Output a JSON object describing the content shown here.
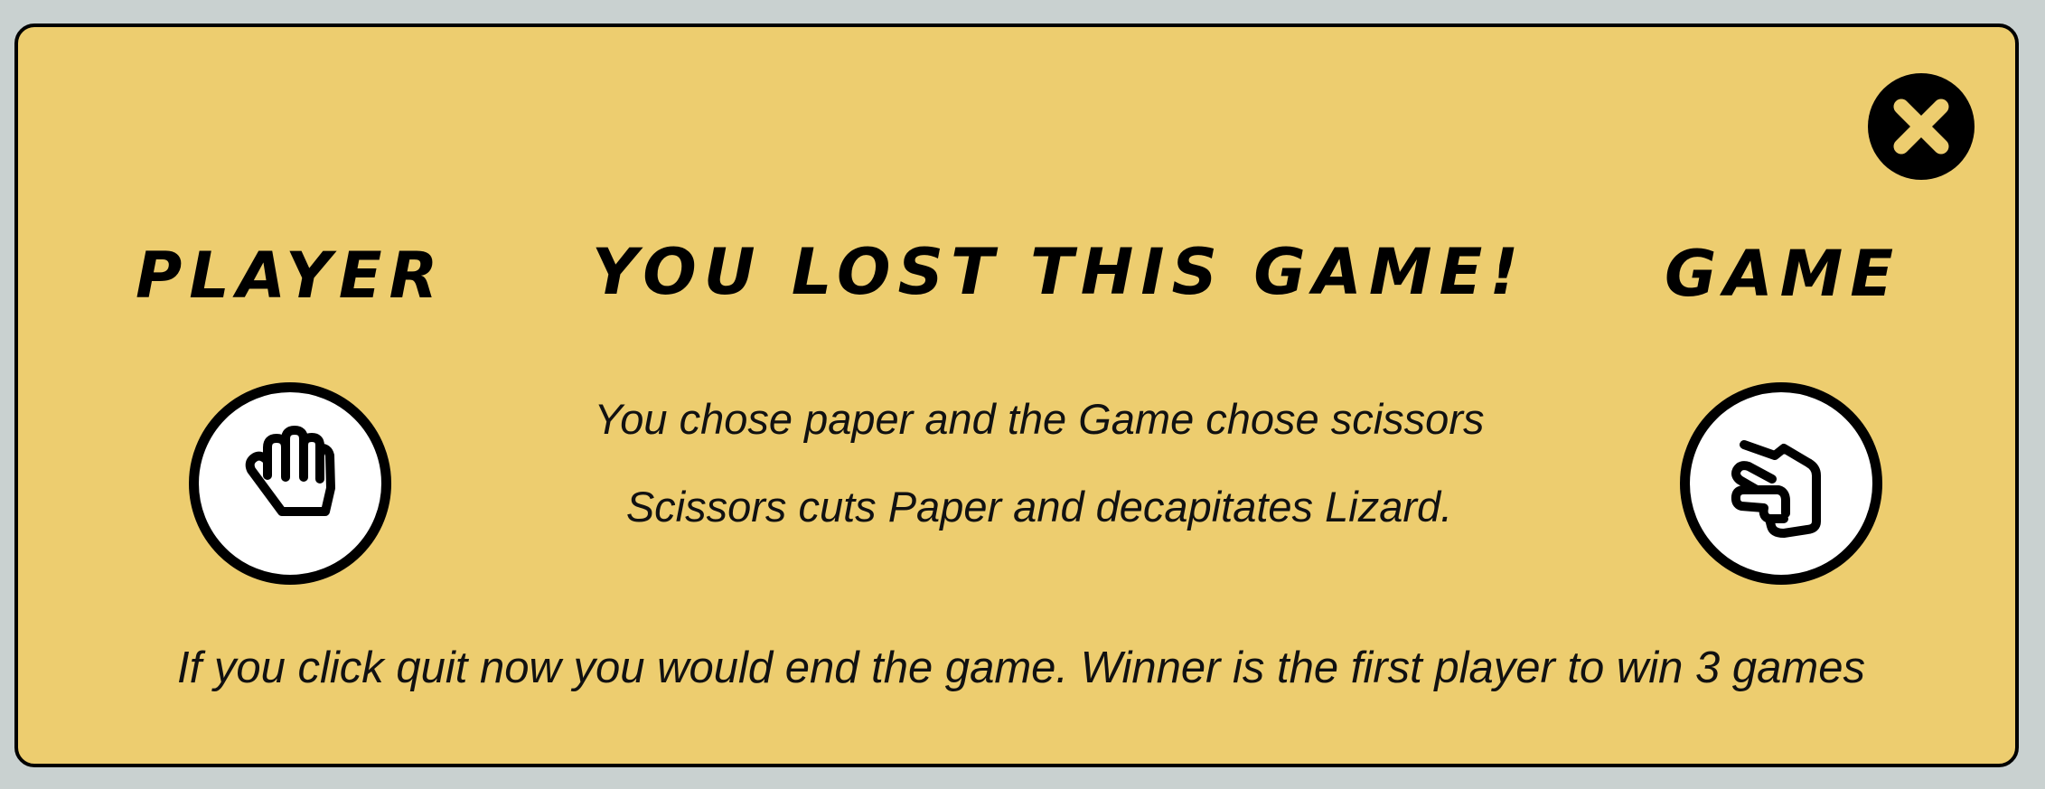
{
  "modal": {
    "close_icon": "close-icon",
    "player_heading": "Player",
    "result_heading": "You lost this game!",
    "game_heading": "Game",
    "player_choice": {
      "name": "paper",
      "icon": "paper-hand-icon"
    },
    "game_choice": {
      "name": "scissors",
      "icon": "scissors-hand-icon"
    },
    "choices_text": "You chose paper and the Game chose scissors",
    "rule_text": "Scissors cuts Paper and decapitates Lizard.",
    "footer_text": "If you click quit now you would end the game. Winner is the first player to win 3 games"
  },
  "colors": {
    "page_background": "#c9d1d0",
    "modal_background": "#edcd6f",
    "border": "#000000",
    "icon_background": "#ffffff"
  }
}
